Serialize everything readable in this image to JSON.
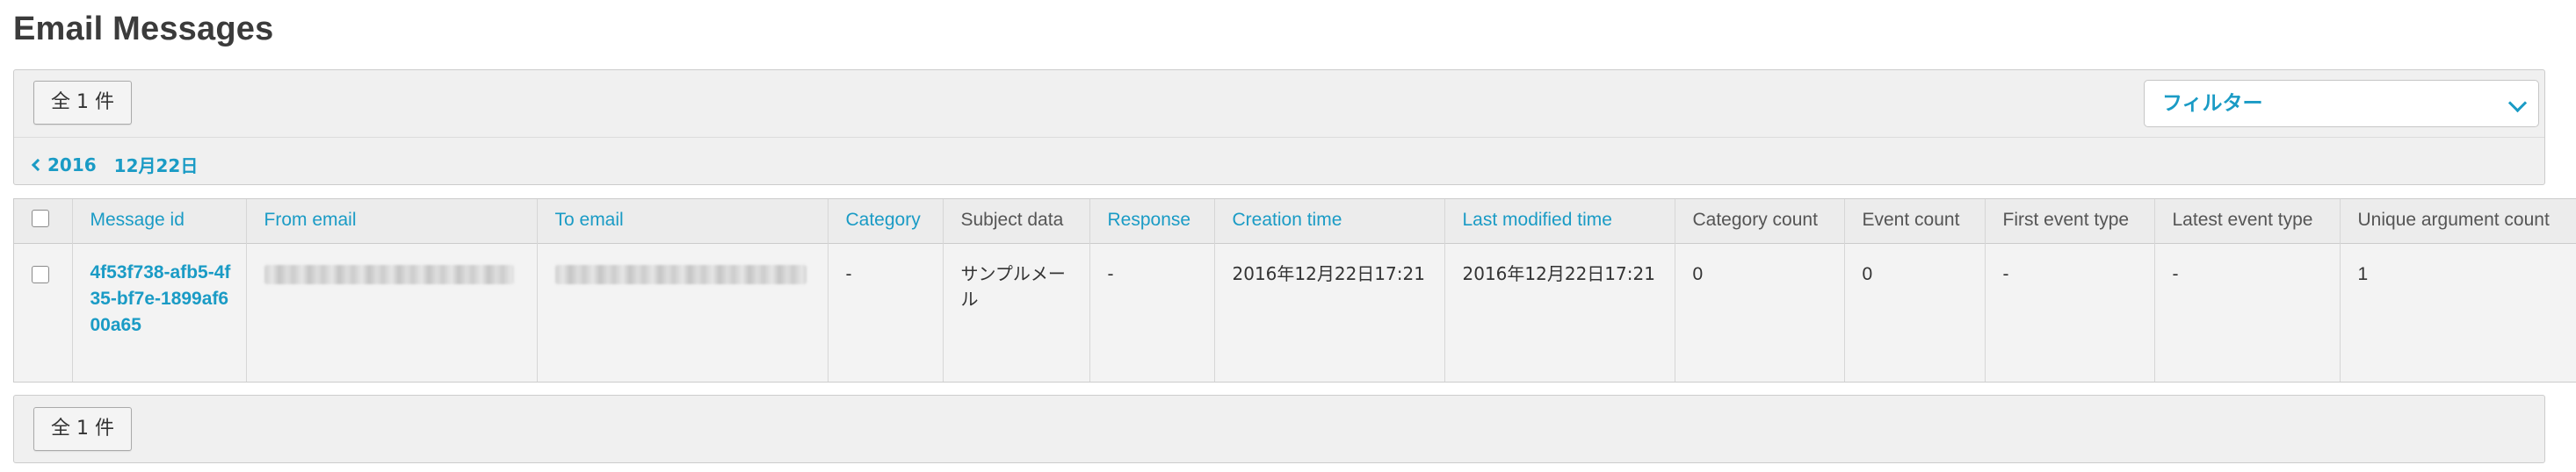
{
  "page": {
    "title": "Email Messages"
  },
  "toolbar_top": {
    "count_label": "全 1 件",
    "filter_label": "フィルター"
  },
  "breadcrumb": {
    "year": "2016",
    "day": "12月22日"
  },
  "table": {
    "columns": [
      {
        "label": "Message id"
      },
      {
        "label": "From email"
      },
      {
        "label": "To email"
      },
      {
        "label": "Category"
      },
      {
        "label": "Subject data"
      },
      {
        "label": "Response"
      },
      {
        "label": "Creation time"
      },
      {
        "label": "Last modified time"
      },
      {
        "label": "Category count"
      },
      {
        "label": "Event count"
      },
      {
        "label": "First event type"
      },
      {
        "label": "Latest event type"
      },
      {
        "label": "Unique argument count"
      }
    ],
    "rows": [
      {
        "message_id": "4f53f738-afb5-4f35-bf7e-1899af600a65",
        "category": "-",
        "subject_data": "サンプルメール",
        "response": "-",
        "creation_time": "2016年12月22日17:21",
        "last_modified_time": "2016年12月22日17:21",
        "category_count": "0",
        "event_count": "0",
        "first_event_type": "-",
        "latest_event_type": "-",
        "unique_argument_count": "1"
      }
    ]
  },
  "toolbar_bottom": {
    "count_label": "全 1 件"
  },
  "colors": {
    "accent": "#1a9bc5",
    "panel": "#f0f0f0",
    "border": "#cccccc"
  },
  "icons": {
    "breadcrumb_back": "chevron-left-icon",
    "filter_toggle": "chevron-down-icon"
  }
}
